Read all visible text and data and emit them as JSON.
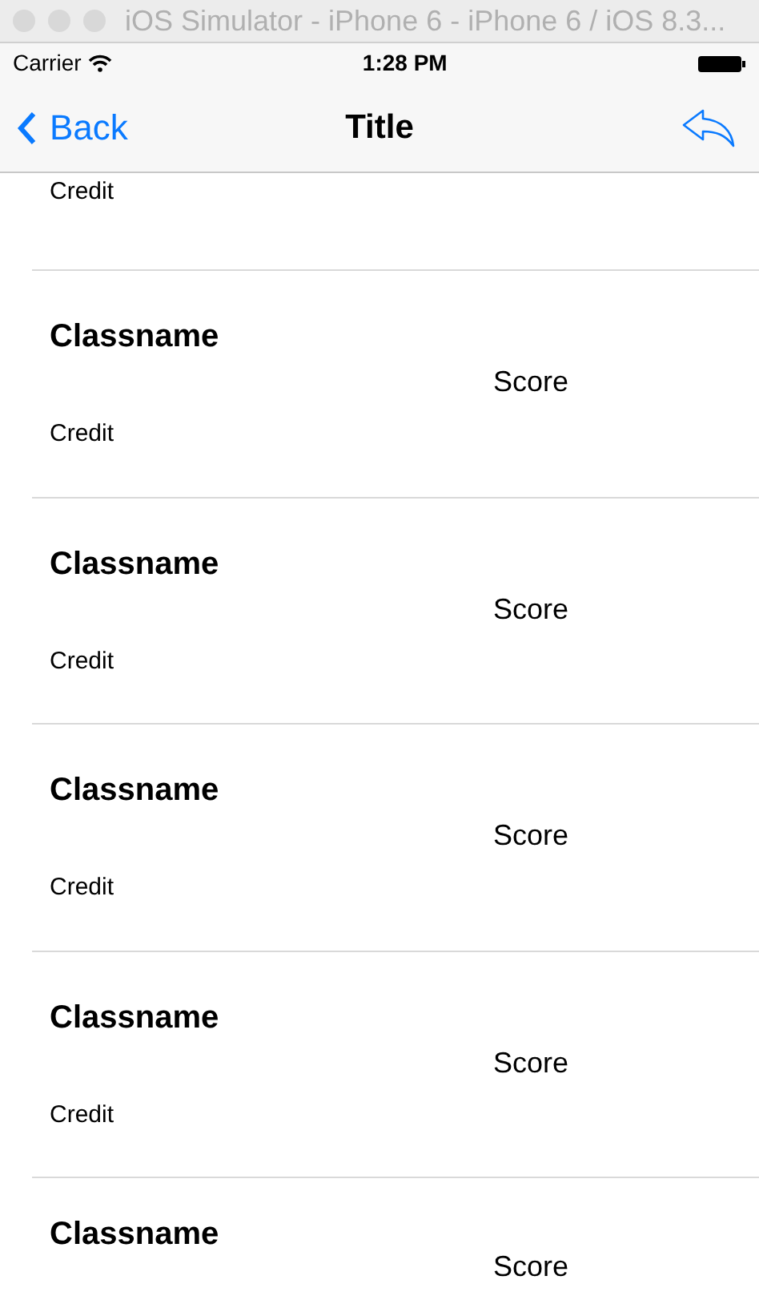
{
  "window": {
    "title": "iOS Simulator - iPhone 6 - iPhone 6 / iOS 8.3..."
  },
  "status_bar": {
    "carrier": "Carrier",
    "time": "1:28 PM"
  },
  "nav_bar": {
    "back": "Back",
    "title": "Title"
  },
  "cells": [
    {
      "credit": "Credit"
    },
    {
      "classname": "Classname",
      "score": "Score",
      "credit": "Credit"
    },
    {
      "classname": "Classname",
      "score": "Score",
      "credit": "Credit"
    },
    {
      "classname": "Classname",
      "score": "Score",
      "credit": "Credit"
    },
    {
      "classname": "Classname",
      "score": "Score",
      "credit": "Credit"
    },
    {
      "classname": "Classname",
      "score": "Score"
    }
  ]
}
